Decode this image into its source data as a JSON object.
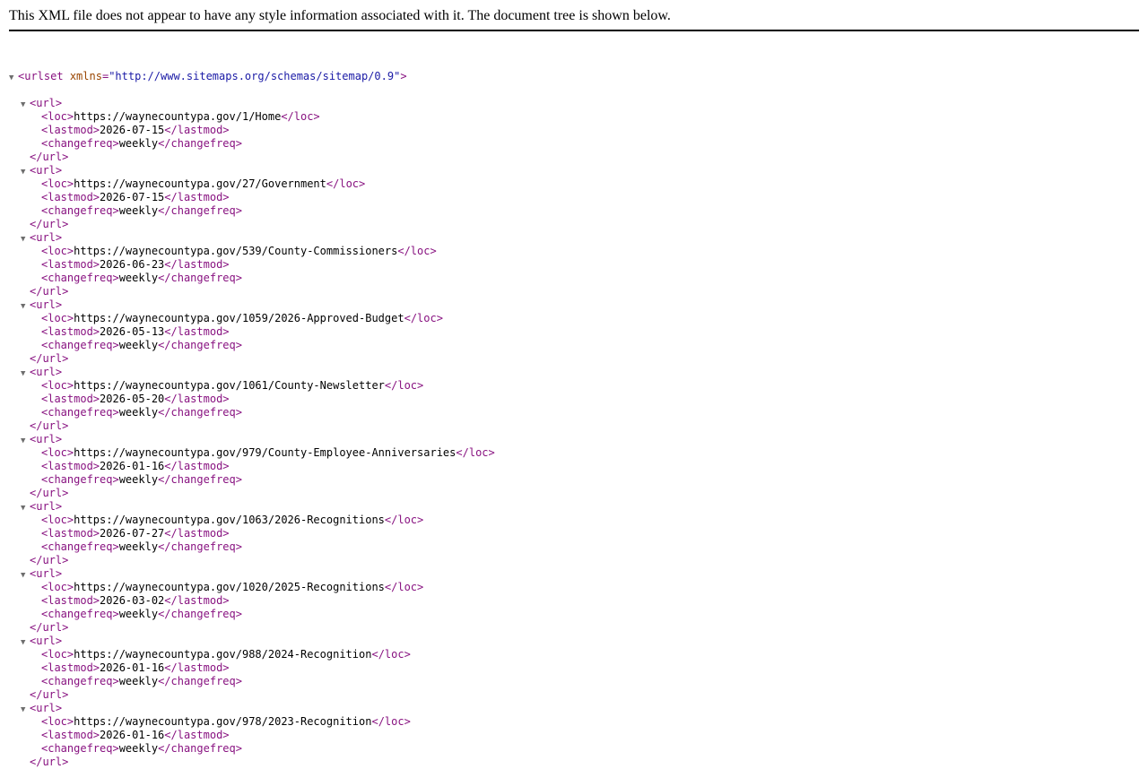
{
  "notice": "This XML file does not appear to have any style information associated with it. The document tree is shown below.",
  "toggle_glyph": "▼",
  "urlset": {
    "tag": "urlset",
    "attr_name": "xmlns",
    "attr_value": "http://www.sitemaps.org/schemas/sitemap/0.9"
  },
  "urls": [
    {
      "loc": "https://waynecountypa.gov/1/Home",
      "lastmod": "2026-07-15",
      "changefreq": "weekly"
    },
    {
      "loc": "https://waynecountypa.gov/27/Government",
      "lastmod": "2026-07-15",
      "changefreq": "weekly"
    },
    {
      "loc": "https://waynecountypa.gov/539/County-Commissioners",
      "lastmod": "2026-06-23",
      "changefreq": "weekly"
    },
    {
      "loc": "https://waynecountypa.gov/1059/2026-Approved-Budget",
      "lastmod": "2026-05-13",
      "changefreq": "weekly"
    },
    {
      "loc": "https://waynecountypa.gov/1061/County-Newsletter",
      "lastmod": "2026-05-20",
      "changefreq": "weekly"
    },
    {
      "loc": "https://waynecountypa.gov/979/County-Employee-Anniversaries",
      "lastmod": "2026-01-16",
      "changefreq": "weekly"
    },
    {
      "loc": "https://waynecountypa.gov/1063/2026-Recognitions",
      "lastmod": "2026-07-27",
      "changefreq": "weekly"
    },
    {
      "loc": "https://waynecountypa.gov/1020/2025-Recognitions",
      "lastmod": "2026-03-02",
      "changefreq": "weekly"
    },
    {
      "loc": "https://waynecountypa.gov/988/2024-Recognition",
      "lastmod": "2026-01-16",
      "changefreq": "weekly"
    },
    {
      "loc": "https://waynecountypa.gov/978/2023-Recognition",
      "lastmod": "2026-01-16",
      "changefreq": "weekly"
    }
  ]
}
